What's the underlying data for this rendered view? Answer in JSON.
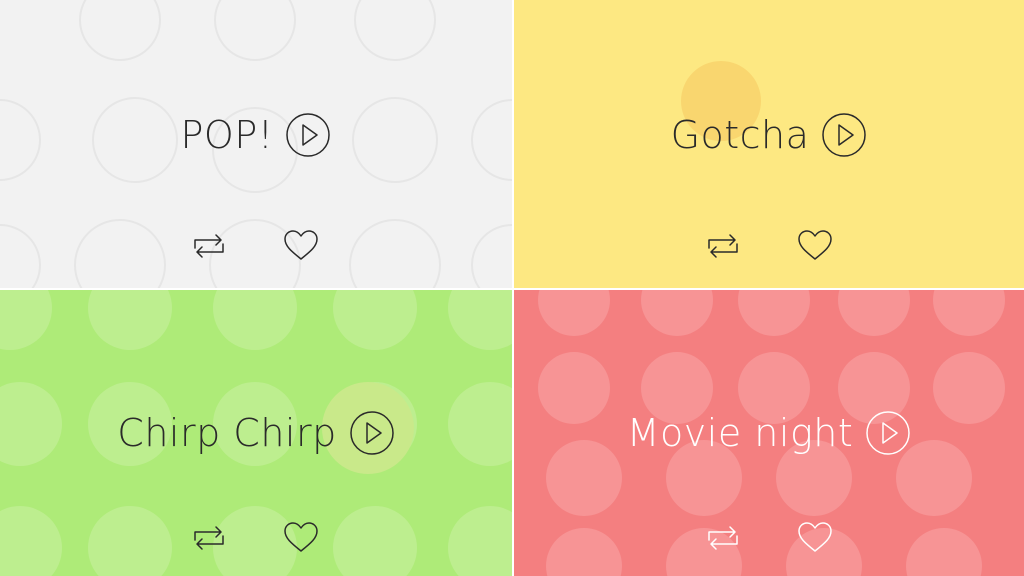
{
  "tiles": [
    {
      "title": "POP!",
      "bg": "#f2f2f2",
      "ink": "#2a2a2a",
      "pattern": "rings",
      "spot": "#eceaea"
    },
    {
      "title": "Gotcha",
      "bg": "#fde882",
      "ink": "#2a2a2a",
      "pattern": "none",
      "spot": "#f9d66f"
    },
    {
      "title": "Chirp Chirp",
      "bg": "#aeeb78",
      "ink": "#2a2a2a",
      "pattern": "dots",
      "spot": "#c4ea86"
    },
    {
      "title": "Movie night",
      "bg": "#f47f80",
      "ink": "#ffffff",
      "pattern": "dots",
      "spot": "#f79495"
    }
  ],
  "icons": {
    "play": "play-circle-icon",
    "repeat": "repeat-icon",
    "heart": "heart-icon"
  }
}
